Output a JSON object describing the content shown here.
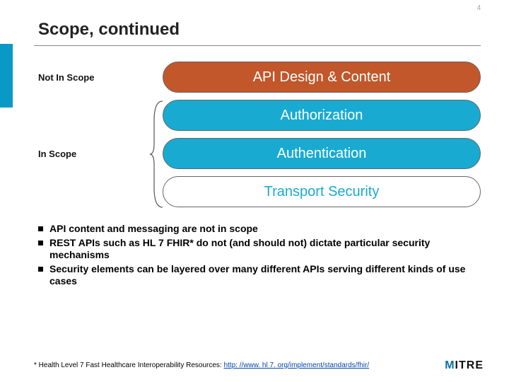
{
  "page_number": "4",
  "title": "Scope, continued",
  "labels": {
    "not_in_scope": "Not In Scope",
    "in_scope": "In Scope"
  },
  "pills": {
    "api": "API Design & Content",
    "authz": "Authorization",
    "authn": "Authentication",
    "transport": "Transport Security"
  },
  "bullets": [
    "API content and messaging are not in scope",
    "REST APIs such as HL 7 FHIR* do not (and should not) dictate particular security mechanisms",
    "Security elements can be layered over many different APIs serving different kinds of use cases"
  ],
  "footnote": {
    "prefix": "* Health Level 7 Fast Healthcare Interoperability Resources: ",
    "link_text": "http: //www. hl 7. org/implement/standards/fhir/",
    "link_href": "http://www.hl7.org/implement/standards/fhir/"
  },
  "logo": {
    "m": "M",
    "rest": "ITRE"
  }
}
